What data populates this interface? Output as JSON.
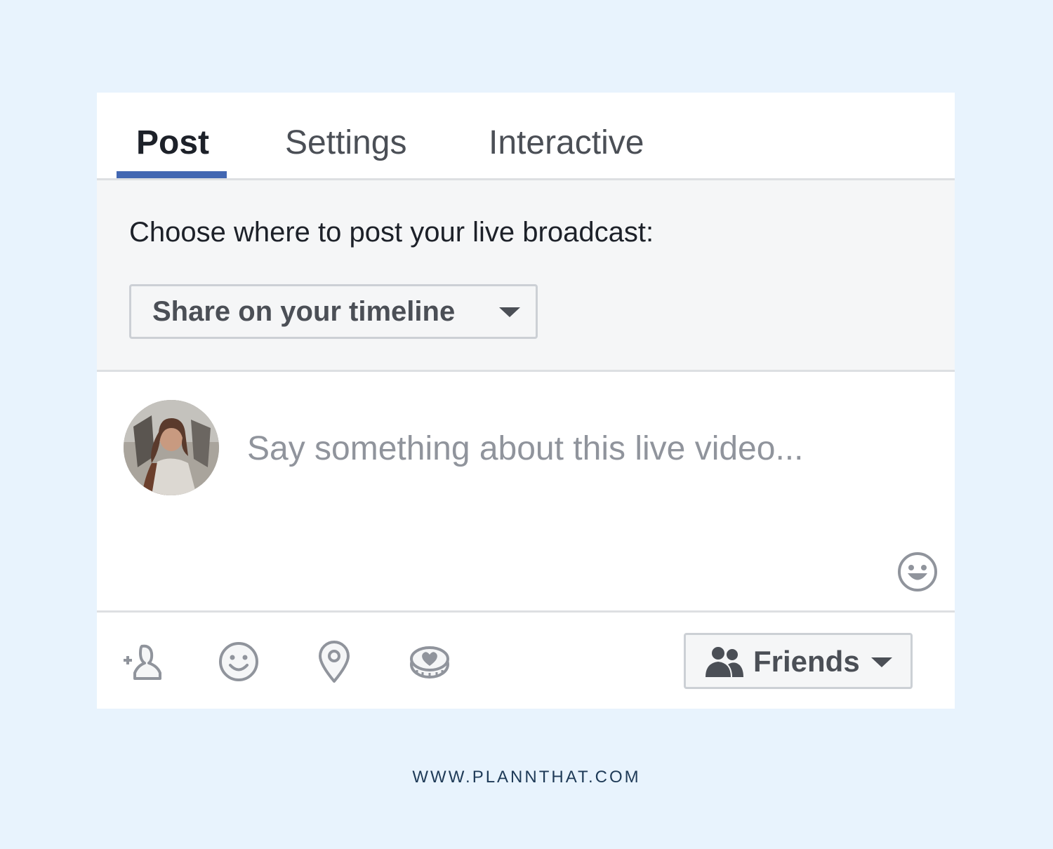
{
  "tabs": [
    {
      "label": "Post",
      "active": true
    },
    {
      "label": "Settings",
      "active": false
    },
    {
      "label": "Interactive",
      "active": false
    }
  ],
  "destination": {
    "label": "Choose where to post your live broadcast:",
    "selected": "Share on your timeline"
  },
  "composer": {
    "placeholder": "Say something about this live video..."
  },
  "footer": {
    "icons": [
      "tag-friends-icon",
      "feeling-icon",
      "location-icon",
      "fundraiser-icon"
    ],
    "audience": "Friends"
  },
  "watermark": "WWW.PLANNTHAT.COM",
  "colors": {
    "accent": "#4267b2",
    "background": "#e8f3fd",
    "icon_gray": "#90949c",
    "section_gray": "#f5f6f7"
  }
}
